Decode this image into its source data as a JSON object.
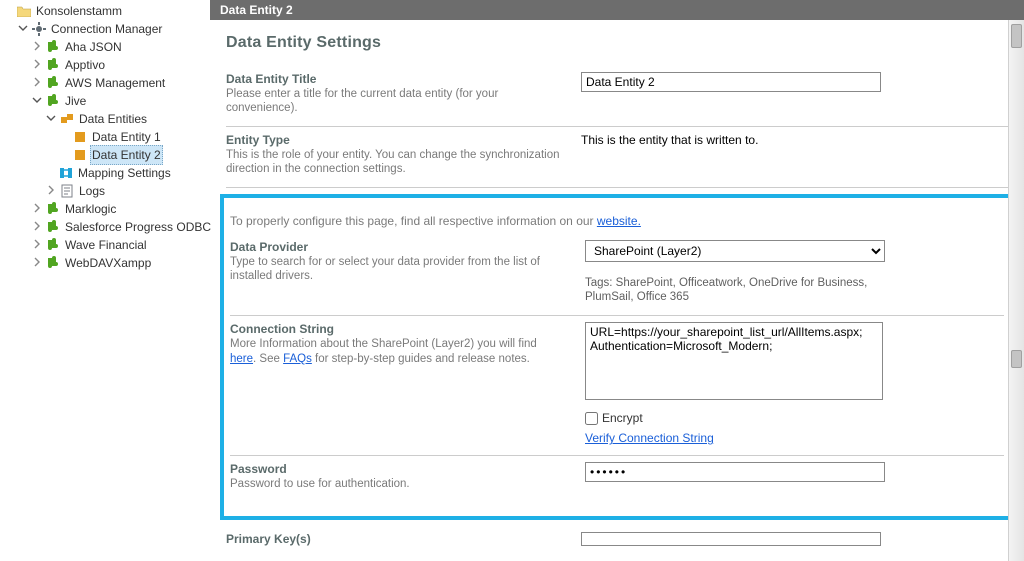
{
  "tree": {
    "root": {
      "label": "Konsolenstamm"
    },
    "conn_mgr": {
      "label": "Connection Manager"
    },
    "items": {
      "aha": "Aha JSON",
      "apptivo": "Apptivo",
      "aws": "AWS Management",
      "jive": "Jive",
      "marklogic": "Marklogic",
      "salesforce": "Salesforce Progress ODBC",
      "wave": "Wave Financial",
      "webdav": "WebDAVXampp"
    },
    "jive_children": {
      "data_entities": "Data Entities",
      "de1": "Data Entity 1",
      "de2": "Data Entity 2",
      "mapping": "Mapping Settings",
      "logs": "Logs"
    }
  },
  "header": {
    "title": "Data Entity 2"
  },
  "page": {
    "heading": "Data Entity Settings",
    "info_prefix": "To properly configure this page, find all respective information on our ",
    "info_link": "website.",
    "sections": {
      "title": {
        "label": "Data Entity Title",
        "desc": "Please enter a title for the current data entity (for your convenience).",
        "value": "Data Entity 2"
      },
      "entity_type": {
        "label": "Entity Type",
        "desc": "This is the role of your entity. You can change the synchronization direction in the connection settings.",
        "value": "This is the entity that is written to."
      },
      "provider": {
        "label": "Data Provider",
        "desc": "Type to search for or select your data provider from the list of installed drivers.",
        "value": "SharePoint (Layer2)",
        "tags": "Tags: SharePoint, Officeatwork, OneDrive for Business, PlumSail, Office 365"
      },
      "connstr": {
        "label": "Connection String",
        "desc_pre": "More Information about the SharePoint (Layer2) you will find ",
        "desc_link1": "here",
        "desc_mid": ". See ",
        "desc_link2": "FAQs",
        "desc_post": " for step-by-step guides and release notes.",
        "value": "URL=https://your_sharepoint_list_url/AllItems.aspx;\nAuthentication=Microsoft_Modern;",
        "encrypt_label": "Encrypt",
        "verify_label": "Verify Connection String"
      },
      "password": {
        "label": "Password",
        "desc": "Password to use for authentication.",
        "value": "••••••"
      },
      "pk": {
        "label": "Primary Key(s)"
      }
    }
  }
}
